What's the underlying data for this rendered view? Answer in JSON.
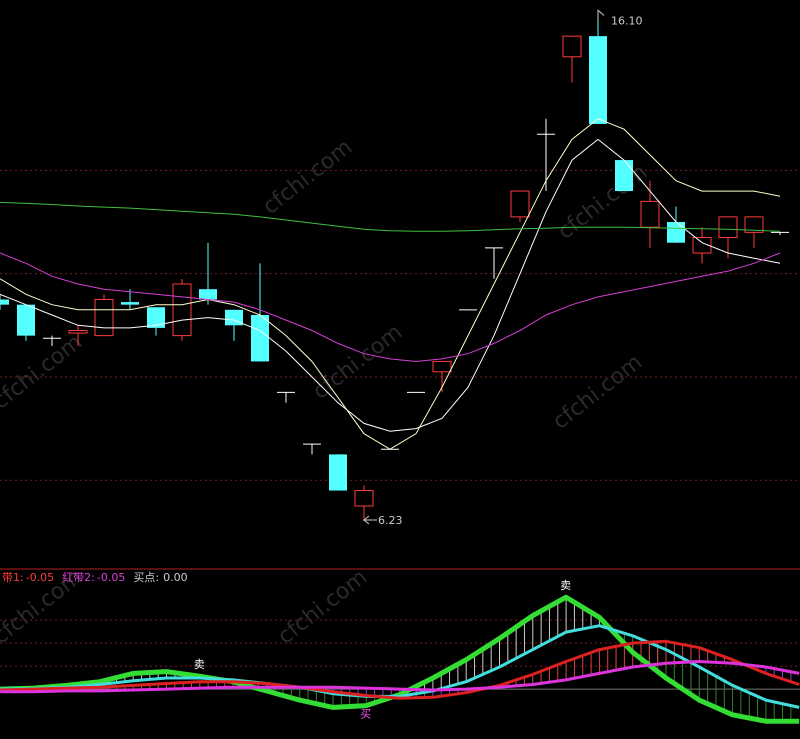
{
  "colors": {
    "background": "#000000",
    "grid": "#7a1e1e",
    "separator": "#b02020",
    "candle_up": "#ff3c3c",
    "candle_down": "#54ffff",
    "ma_white": "#ffffff",
    "ma_yellow": "#ffffcc",
    "ma_magenta": "#d83fd8",
    "ma_green": "#3fbf3f",
    "green_band": "#33dd33",
    "cyan_band": "#44dddd",
    "red_band": "#dd2020",
    "magenta_band": "#dd33dd",
    "annot_sell": "#ffffff",
    "annot_buy": "#ff55ff"
  },
  "watermark": "cfchi.com",
  "main_panel": {
    "high_label": "16.10",
    "low_label": "6.23"
  },
  "indicator_header": {
    "items": [
      {
        "label": "带1:",
        "value": "-0.05",
        "color": "#ff3c3c"
      },
      {
        "label": "红带2:",
        "value": "-0.05",
        "color": "#d83fd8"
      },
      {
        "label": "买点:",
        "value": "0.00",
        "color": "#cccccc"
      }
    ]
  },
  "chart_data": [
    {
      "type": "candlestick",
      "title": "",
      "ylim": [
        5.3,
        16.3
      ],
      "candles": [
        {
          "o": 10.5,
          "h": 10.6,
          "l": 10.3,
          "c": 10.4
        },
        {
          "o": 10.4,
          "h": 10.4,
          "l": 9.7,
          "c": 9.8
        },
        {
          "o": 9.75,
          "h": 9.8,
          "l": 9.6,
          "c": 9.75
        },
        {
          "o": 9.85,
          "h": 10.0,
          "l": 9.6,
          "c": 9.9
        },
        {
          "o": 9.8,
          "h": 10.6,
          "l": 9.8,
          "c": 10.5
        },
        {
          "o": 10.45,
          "h": 10.7,
          "l": 10.3,
          "c": 10.4
        },
        {
          "o": 10.35,
          "h": 10.35,
          "l": 9.8,
          "c": 9.95
        },
        {
          "o": 9.8,
          "h": 10.9,
          "l": 9.7,
          "c": 10.8
        },
        {
          "o": 10.7,
          "h": 11.6,
          "l": 10.4,
          "c": 10.5
        },
        {
          "o": 10.3,
          "h": 10.3,
          "l": 9.7,
          "c": 10.0
        },
        {
          "o": 10.2,
          "h": 11.2,
          "l": 9.3,
          "c": 9.3
        },
        {
          "o": 8.7,
          "h": 8.7,
          "l": 8.5,
          "c": 8.7
        },
        {
          "o": 7.7,
          "h": 7.7,
          "l": 7.5,
          "c": 7.7
        },
        {
          "o": 7.5,
          "h": 7.5,
          "l": 6.8,
          "c": 6.8
        },
        {
          "o": 6.5,
          "h": 6.9,
          "l": 6.23,
          "c": 6.8
        },
        {
          "o": 7.6,
          "h": 7.6,
          "l": 7.6,
          "c": 7.6
        },
        {
          "o": 8.7,
          "h": 8.7,
          "l": 8.7,
          "c": 8.7
        },
        {
          "o": 9.1,
          "h": 9.3,
          "l": 8.7,
          "c": 9.3
        },
        {
          "o": 10.3,
          "h": 10.3,
          "l": 10.3,
          "c": 10.3
        },
        {
          "o": 11.5,
          "h": 11.5,
          "l": 10.9,
          "c": 11.5
        },
        {
          "o": 12.1,
          "h": 12.6,
          "l": 12.0,
          "c": 12.6
        },
        {
          "o": 13.7,
          "h": 14.0,
          "l": 12.6,
          "c": 13.7
        },
        {
          "o": 15.2,
          "h": 15.6,
          "l": 14.7,
          "c": 15.6
        },
        {
          "o": 15.6,
          "h": 16.1,
          "l": 13.9,
          "c": 13.9
        },
        {
          "o": 13.2,
          "h": 13.2,
          "l": 12.6,
          "c": 12.6
        },
        {
          "o": 11.9,
          "h": 12.8,
          "l": 11.5,
          "c": 12.4
        },
        {
          "o": 12.0,
          "h": 12.3,
          "l": 11.6,
          "c": 11.6
        },
        {
          "o": 11.4,
          "h": 11.9,
          "l": 11.2,
          "c": 11.7
        },
        {
          "o": 11.7,
          "h": 12.1,
          "l": 11.3,
          "c": 12.1
        },
        {
          "o": 11.8,
          "h": 12.1,
          "l": 11.5,
          "c": 12.1
        },
        {
          "o": 11.8,
          "h": 11.8,
          "l": 11.75,
          "c": 11.8
        }
      ],
      "ma_series": [
        {
          "color_key": "ma_yellow",
          "values": [
            10.9,
            10.6,
            10.4,
            10.3,
            10.3,
            10.3,
            10.4,
            10.4,
            10.5,
            10.4,
            10.2,
            9.8,
            9.3,
            8.6,
            7.9,
            7.6,
            7.9,
            8.8,
            9.8,
            10.8,
            11.8,
            12.8,
            13.6,
            14.0,
            13.8,
            13.3,
            12.8,
            12.6,
            12.6,
            12.6,
            12.5
          ]
        },
        {
          "color_key": "ma_white",
          "values": [
            10.6,
            10.4,
            10.2,
            10.0,
            9.95,
            9.95,
            10.0,
            10.1,
            10.15,
            10.1,
            9.9,
            9.5,
            9.0,
            8.5,
            8.1,
            7.95,
            8.0,
            8.2,
            8.8,
            9.8,
            11.0,
            12.2,
            13.2,
            13.6,
            13.2,
            12.6,
            12.0,
            11.6,
            11.4,
            11.3,
            11.2
          ]
        },
        {
          "color_key": "ma_magenta",
          "values": [
            11.4,
            11.2,
            10.95,
            10.8,
            10.7,
            10.65,
            10.6,
            10.55,
            10.5,
            10.45,
            10.3,
            10.1,
            9.9,
            9.65,
            9.45,
            9.35,
            9.3,
            9.35,
            9.45,
            9.65,
            9.9,
            10.2,
            10.4,
            10.55,
            10.65,
            10.75,
            10.85,
            10.95,
            11.05,
            11.2,
            11.4
          ]
        },
        {
          "color_key": "ma_green",
          "values": [
            12.38,
            12.36,
            12.34,
            12.31,
            12.29,
            12.27,
            12.24,
            12.21,
            12.18,
            12.15,
            12.1,
            12.04,
            11.98,
            11.92,
            11.86,
            11.83,
            11.82,
            11.82,
            11.83,
            11.85,
            11.87,
            11.88,
            11.9,
            11.9,
            11.9,
            11.89,
            11.88,
            11.87,
            11.86,
            11.84,
            11.82
          ]
        }
      ]
    },
    {
      "type": "line",
      "title": "",
      "ylim": [
        -0.5,
        1.1
      ],
      "zero_line": 0,
      "series": [
        {
          "color_key": "green_band",
          "values": [
            0.0,
            0.01,
            0.04,
            0.08,
            0.17,
            0.19,
            0.14,
            0.08,
            -0.02,
            -0.12,
            -0.2,
            -0.18,
            -0.06,
            0.12,
            0.32,
            0.55,
            0.8,
            1.0,
            0.78,
            0.4,
            0.12,
            -0.12,
            -0.28,
            -0.35,
            -0.35
          ]
        },
        {
          "color_key": "cyan_band",
          "values": [
            0.0,
            0.005,
            0.02,
            0.05,
            0.09,
            0.12,
            0.12,
            0.1,
            0.06,
            0.02,
            -0.05,
            -0.08,
            -0.08,
            -0.02,
            0.08,
            0.24,
            0.43,
            0.62,
            0.69,
            0.58,
            0.43,
            0.24,
            0.04,
            -0.12,
            -0.2
          ]
        },
        {
          "color_key": "red_band",
          "values": [
            -0.01,
            0.0,
            0.01,
            0.02,
            0.04,
            0.06,
            0.08,
            0.08,
            0.06,
            0.02,
            -0.03,
            -0.07,
            -0.1,
            -0.09,
            -0.04,
            0.04,
            0.16,
            0.3,
            0.43,
            0.5,
            0.52,
            0.45,
            0.32,
            0.17,
            0.05
          ]
        },
        {
          "color_key": "magenta_band",
          "values": [
            -0.03,
            -0.03,
            -0.02,
            -0.02,
            -0.01,
            0.0,
            0.01,
            0.02,
            0.02,
            0.02,
            0.02,
            0.01,
            0.0,
            -0.01,
            0.0,
            0.02,
            0.05,
            0.1,
            0.17,
            0.24,
            0.28,
            0.3,
            0.28,
            0.24,
            0.17
          ]
        }
      ],
      "annotations": [
        {
          "text": "卖",
          "index": 6,
          "color_key": "annot_sell"
        },
        {
          "text": "买",
          "index": 11,
          "color_key": "annot_buy"
        },
        {
          "text": "卖",
          "index": 17,
          "color_key": "annot_sell"
        }
      ]
    }
  ]
}
